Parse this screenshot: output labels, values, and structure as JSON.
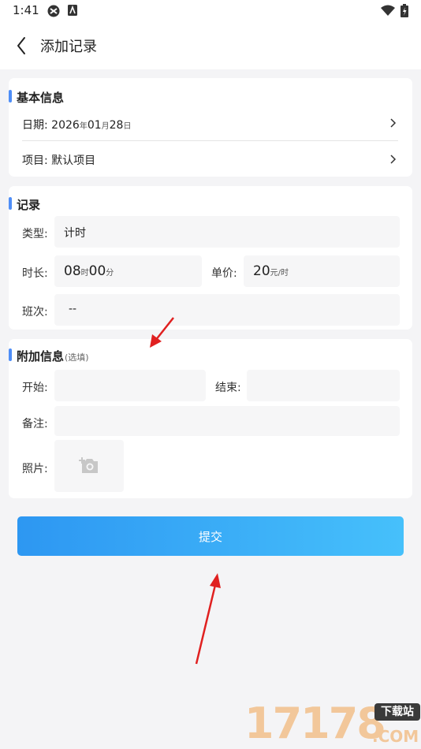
{
  "status": {
    "time": "1:41"
  },
  "header": {
    "title": "添加记录"
  },
  "basic": {
    "title": "基本信息",
    "date_label": "日期: ",
    "date_year": "2026",
    "year_unit": "年",
    "date_month": "01",
    "month_unit": "月",
    "date_day": "28",
    "day_unit": "日",
    "project_label": "项目: ",
    "project_value": "默认项目"
  },
  "record": {
    "title": "记录",
    "type_label": "类型:",
    "type_value": "计时",
    "duration_label": "时长:",
    "hours": "08",
    "hour_unit": "时",
    "minutes": "00",
    "minute_unit": "分",
    "price_label": "单价:",
    "price": "20",
    "price_unit": "元/时",
    "shift_label": "班次:",
    "shift_value": "--"
  },
  "extra": {
    "title": "附加信息",
    "optional": "(选填)",
    "start_label": "开始:",
    "end_label": "结束:",
    "note_label": "备注:",
    "photo_label": "照片:"
  },
  "submit_label": "提交",
  "watermark": {
    "number": "17178",
    "tag": "下载站",
    "domain": ".COM"
  },
  "colors": {
    "accent": "#4f8ef7",
    "button_start": "#2d97f2",
    "button_end": "#46c0fb",
    "annotation": "#e02020"
  }
}
